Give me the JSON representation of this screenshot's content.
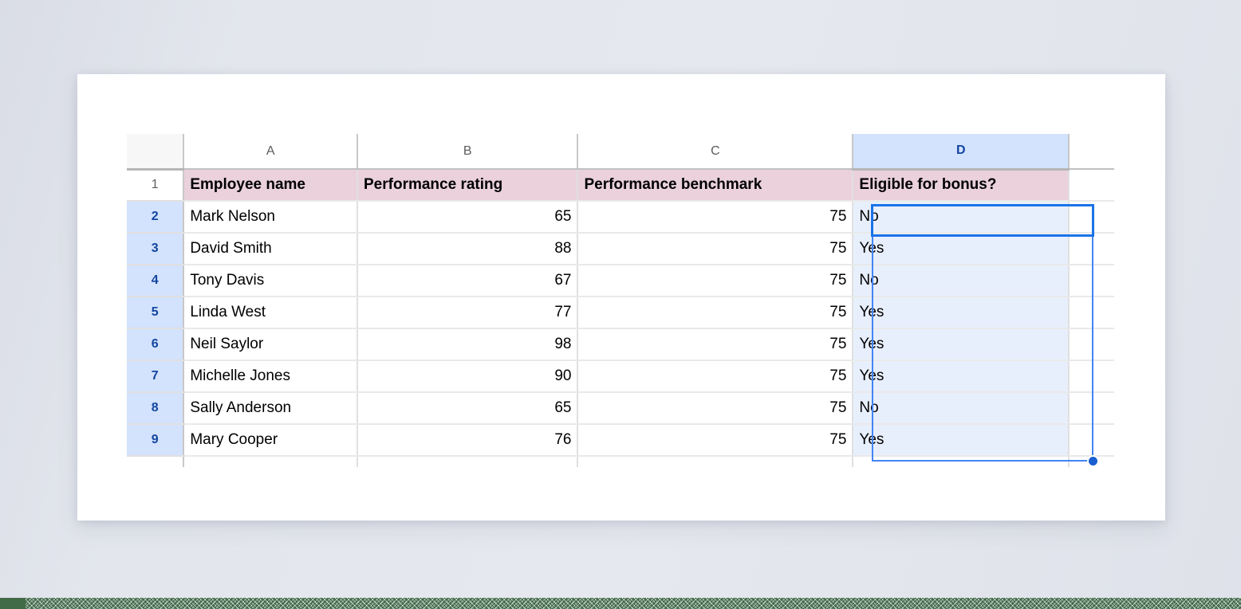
{
  "spreadsheet": {
    "column_headers": [
      "A",
      "B",
      "C",
      "D"
    ],
    "selected_column": "D",
    "row_headers": [
      "1",
      "2",
      "3",
      "4",
      "5",
      "6",
      "7",
      "8",
      "9"
    ],
    "selected_rows": [
      "2",
      "3",
      "4",
      "5",
      "6",
      "7",
      "8",
      "9"
    ],
    "active_cell": "D2",
    "selection_range": "D2:D9",
    "header_row": {
      "a": "Employee name",
      "b": "Performance rating",
      "c": "Performance benchmark",
      "d": "Eligible for bonus?"
    },
    "rows": [
      {
        "row": "2",
        "name": "Mark Nelson",
        "rating": "65",
        "benchmark": "75",
        "eligible": "No"
      },
      {
        "row": "3",
        "name": "David Smith",
        "rating": "88",
        "benchmark": "75",
        "eligible": "Yes"
      },
      {
        "row": "4",
        "name": "Tony Davis",
        "rating": "67",
        "benchmark": "75",
        "eligible": "No"
      },
      {
        "row": "5",
        "name": "Linda West",
        "rating": "77",
        "benchmark": "75",
        "eligible": "Yes"
      },
      {
        "row": "6",
        "name": "Neil Saylor",
        "rating": "98",
        "benchmark": "75",
        "eligible": "Yes"
      },
      {
        "row": "7",
        "name": "Michelle Jones",
        "rating": "90",
        "benchmark": "75",
        "eligible": "Yes"
      },
      {
        "row": "8",
        "name": "Sally Anderson",
        "rating": "65",
        "benchmark": "75",
        "eligible": "No"
      },
      {
        "row": "9",
        "name": "Mary Cooper",
        "rating": "76",
        "benchmark": "75",
        "eligible": "Yes"
      }
    ],
    "colors": {
      "header_fill": "#ead1dc",
      "selection_fill": "#e8effc",
      "selection_border": "#4285f4",
      "active_cell_border": "#1a73e8",
      "header_selected": "#d3e2fd",
      "fill_handle": "#1a5fd0",
      "page_background": "#e2e5ec",
      "card_background": "#ffffff",
      "accent_strip": "#416b46"
    }
  }
}
